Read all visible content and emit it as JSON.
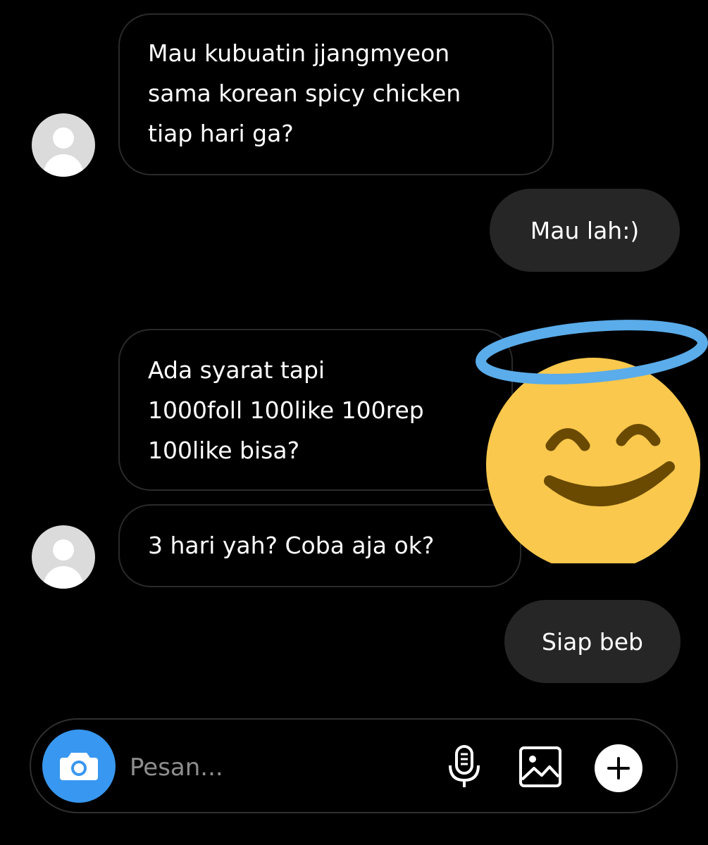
{
  "messages": [
    {
      "direction": "incoming",
      "lines": [
        "Mau kubuatin jjangmyeon",
        "sama korean spicy chicken",
        "tiap hari ga?"
      ]
    },
    {
      "direction": "outgoing",
      "text": "Mau lah:)"
    },
    {
      "direction": "incoming",
      "lines": [
        "Ada syarat tapi",
        "1000foll 100like 100rep",
        "100like bisa?"
      ]
    },
    {
      "direction": "incoming",
      "lines": [
        "3 hari yah? Coba aja ok?"
      ]
    },
    {
      "direction": "outgoing",
      "text": "Siap beb"
    }
  ],
  "sticker": {
    "icon": "smiling-face-with-halo-icon",
    "colors": {
      "face": "#f9c84d",
      "features": "#6a4a00",
      "halo": "#5aacea"
    }
  },
  "composer": {
    "placeholder": "Pesan...",
    "camera_icon": "camera-icon",
    "mic_icon": "microphone-icon",
    "gallery_icon": "image-gallery-icon",
    "add_icon": "plus-icon"
  },
  "colors": {
    "background": "#000000",
    "incoming_border": "#2a2a2a",
    "outgoing_bubble": "#262626",
    "camera_accent": "#3897f0",
    "avatar": "#dbdbdb"
  }
}
